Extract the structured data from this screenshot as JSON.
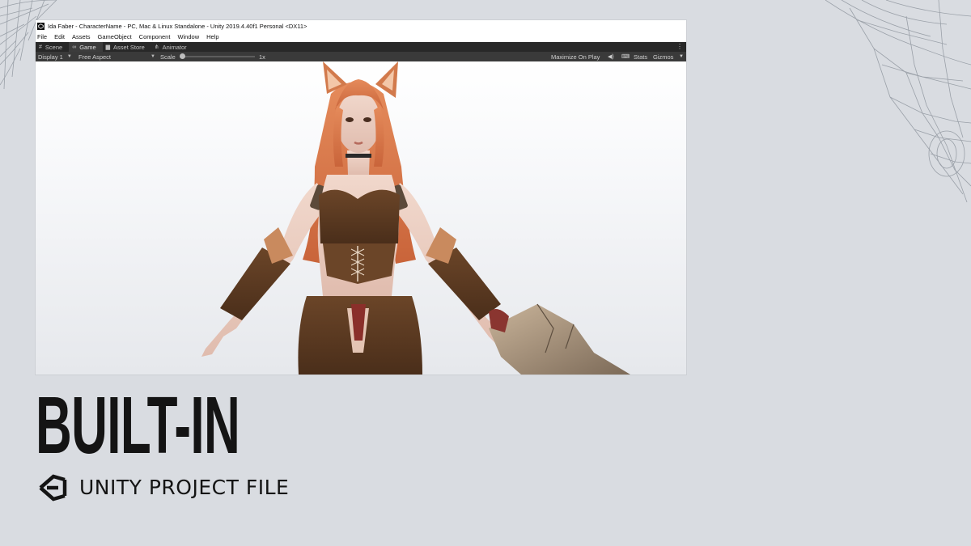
{
  "window": {
    "title": "Ida Faber - CharacterName - PC, Mac & Linux Standalone - Unity 2019.4.40f1 Personal <DX11>"
  },
  "menu": {
    "items": [
      "File",
      "Edit",
      "Assets",
      "GameObject",
      "Component",
      "Window",
      "Help"
    ]
  },
  "tabs": [
    {
      "label": "Scene",
      "icon": "grid-icon"
    },
    {
      "label": "Game",
      "icon": "gamepad-icon"
    },
    {
      "label": "Asset Store",
      "icon": "bag-icon"
    },
    {
      "label": "Animator",
      "icon": "animator-icon"
    }
  ],
  "toolbar": {
    "display": "Display 1",
    "aspect": "Free Aspect",
    "scale_label": "Scale",
    "scale_value": "1x",
    "maximize": "Maximize On Play",
    "stats": "Stats",
    "gizmos": "Gizmos"
  },
  "promo": {
    "headline": "BUILT-IN",
    "subheadline": "UNITY PROJECT FILE"
  },
  "colors": {
    "page_bg": "#d9dce1",
    "tab_bar": "#282828",
    "toolbar": "#3a3a3a",
    "hair": "#d9784a",
    "leather": "#5a3a22"
  }
}
